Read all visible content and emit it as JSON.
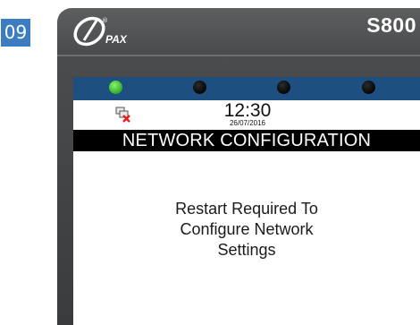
{
  "step": {
    "number": "09",
    "color": "#3b7dc0"
  },
  "device": {
    "brand": "PAX",
    "model": "S800"
  },
  "leds": [
    {
      "name": "led-1",
      "state": "on",
      "color": "#3cc032"
    },
    {
      "name": "led-2",
      "state": "off"
    },
    {
      "name": "led-3",
      "state": "off"
    },
    {
      "name": "led-4",
      "state": "off"
    }
  ],
  "status": {
    "network_icon": "network-disconnected-icon",
    "time": "12:30",
    "date": "26/07/2016"
  },
  "screen": {
    "title": "NETWORK CONFIGURATION",
    "message_lines": [
      "Restart Required To",
      "Configure Network",
      "Settings"
    ]
  },
  "colors": {
    "led_bar": "#1d4f80",
    "title_bar": "#000000",
    "bezel": "#4b4c4e"
  }
}
